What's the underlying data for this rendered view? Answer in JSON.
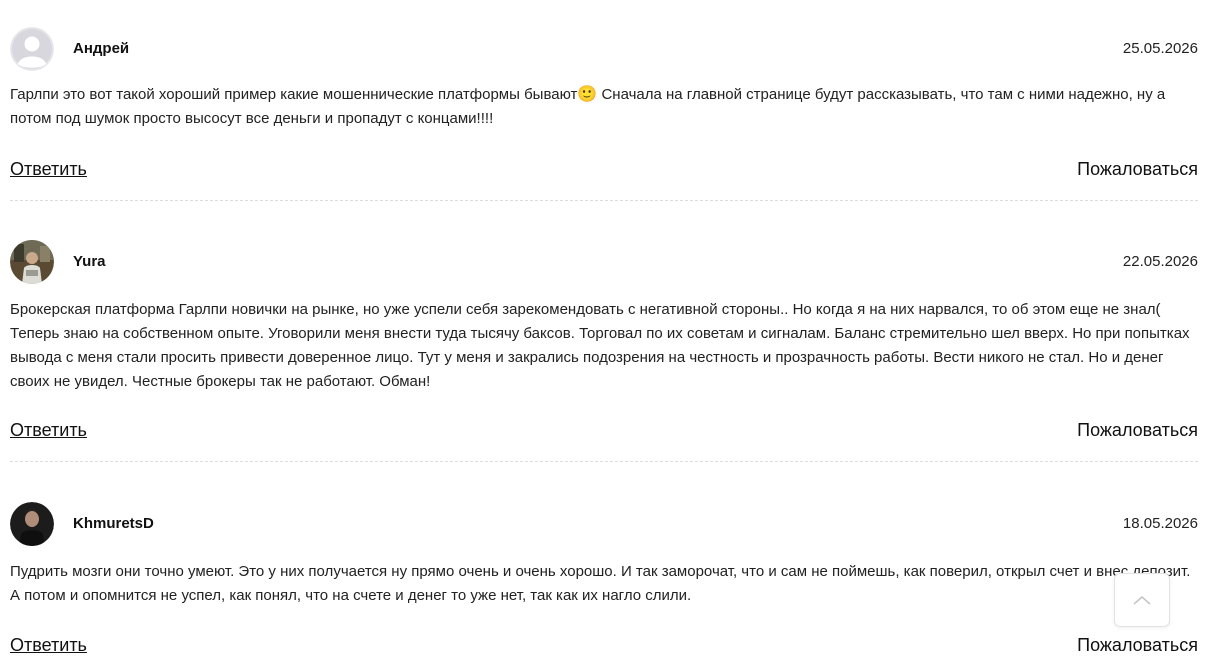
{
  "comments": [
    {
      "author": "Андрей",
      "date": "25.05.2026",
      "text_before_emoji": "Гарлпи это вот такой хороший пример какие мошеннические платформы бывают",
      "emoji": "🙂",
      "text_after_emoji": " Сначала на главной странице будут рассказывать, что там с ними надежно, ну а потом под шумок просто высосут все деньги и пропадут с концами!!!!",
      "reply_label": "Ответить",
      "report_label": "Пожаловаться",
      "avatar": "default-user-avatar"
    },
    {
      "author": "Yura",
      "date": "22.05.2026",
      "text": "Брокерская платформа Гарлпи новички на рынке, но уже успели себя зарекомендовать с негативной стороны.. Но когда я на них нарвался, то об этом еще не знал( Теперь знаю на собственном опыте. Уговорили меня внести туда тысячу баксов. Торговал по их советам и сигналам. Баланс стремительно шел вверх. Но при попытках вывода с меня стали просить привести доверенное лицо. Тут у меня и закрались подозрения на честность и прозрачность работы. Вести никого не стал. Но и денег своих не увидел. Честные брокеры так не работают. Обман!",
      "reply_label": "Ответить",
      "report_label": "Пожаловаться",
      "avatar": "photo-avatar"
    },
    {
      "author": "KhmuretsD",
      "date": "18.05.2026",
      "text": "Пудрить мозги они точно умеют. Это у них получается ну прямо очень и очень хорошо. И так заморочат, что и сам не поймешь, как поверил, открыл счет и внес депозит. А потом и опомнится не успел, как понял, что на счете и денег то уже нет, так как их нагло слили.",
      "reply_label": "Ответить",
      "report_label": "Пожаловаться",
      "avatar": "photo-avatar"
    }
  ],
  "scroll_top": {
    "icon": "chevron-up-icon"
  },
  "colors": {
    "divider": "#dcdcdc",
    "text": "#222222",
    "avatar_default": "#d5d5dc"
  }
}
